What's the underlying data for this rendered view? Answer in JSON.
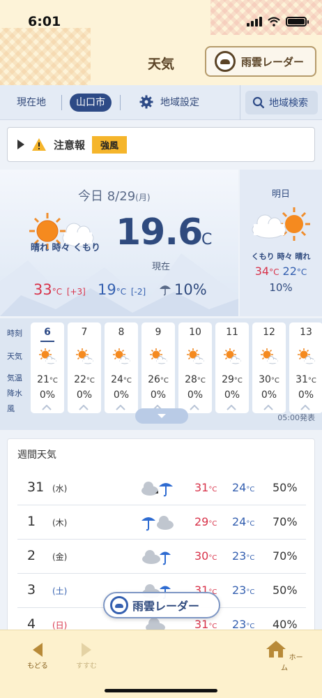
{
  "status_bar": {
    "time": "6:01"
  },
  "header": {
    "title": "天気",
    "radar_button": "雨雲レーダー"
  },
  "tabs": {
    "current_location": "現在地",
    "selected_area": "山口市",
    "area_settings": "地域設定",
    "area_search": "地域検索"
  },
  "alert": {
    "label": "注意報",
    "badge": "強風",
    "badge_color": "#f5b52b"
  },
  "today": {
    "date_label": "今日 8/29",
    "dow": "(月)",
    "description": "晴れ 時々 くもり",
    "current_temp": "19.6",
    "unit": "°C",
    "now_label": "現在",
    "high": "33",
    "high_diff": "[+3]",
    "low": "19",
    "low_diff": "[-2]",
    "rain": "10%"
  },
  "tomorrow": {
    "label": "明日",
    "description": "くもり 時々 晴れ",
    "high": "34",
    "low": "22",
    "rain": "10%"
  },
  "hourly": {
    "row_labels": [
      "時刻",
      "天気",
      "気温",
      "降水",
      "風"
    ],
    "hours": [
      {
        "hour": "6",
        "temp": "21",
        "rain": "0%"
      },
      {
        "hour": "7",
        "temp": "22",
        "rain": "0%"
      },
      {
        "hour": "8",
        "temp": "24",
        "rain": "0%"
      },
      {
        "hour": "9",
        "temp": "26",
        "rain": "0%"
      },
      {
        "hour": "10",
        "temp": "28",
        "rain": "0%"
      },
      {
        "hour": "11",
        "temp": "29",
        "rain": "0%"
      },
      {
        "hour": "12",
        "temp": "30",
        "rain": "0%"
      },
      {
        "hour": "13",
        "temp": "31",
        "rain": "0%"
      }
    ],
    "issued": "05:00発表"
  },
  "weekly": {
    "title": "週間天気",
    "days": [
      {
        "day": "31",
        "dow": "(水)",
        "icon": "cloud-then-rain-icon",
        "high": "31",
        "low": "24",
        "rain": "50%"
      },
      {
        "day": "1",
        "dow": "(木)",
        "icon": "rain-cloud-icon",
        "high": "29",
        "low": "24",
        "rain": "70%"
      },
      {
        "day": "2",
        "dow": "(金)",
        "icon": "cloud-rain-icon",
        "high": "30",
        "low": "23",
        "rain": "70%"
      },
      {
        "day": "3",
        "dow": "(土)",
        "icon": "cloud-rain-icon",
        "high": "31",
        "low": "23",
        "rain": "50%"
      },
      {
        "day": "4",
        "dow": "(日)",
        "icon": "cloud-icon",
        "high": "31",
        "low": "23",
        "rain": "40%"
      }
    ]
  },
  "floating_radar": {
    "label": "雨雲レーダー"
  },
  "footer": {
    "back": "もどる",
    "forward": "すすむ",
    "home": "ホーム"
  },
  "colors": {
    "high": "#d8334a",
    "low": "#3560b0",
    "primary": "#2d4a86",
    "brown": "#5a4326"
  }
}
